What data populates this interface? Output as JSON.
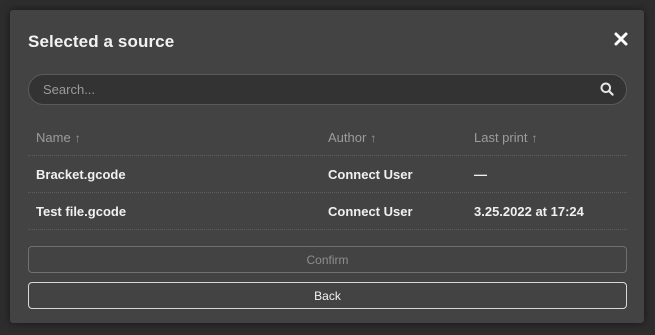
{
  "dialog": {
    "title": "Selected a source",
    "close_icon": "close-icon"
  },
  "search": {
    "placeholder": "Search...",
    "value": "",
    "icon": "search-icon"
  },
  "table": {
    "columns": [
      {
        "label": "Name",
        "sort_indicator": "↑"
      },
      {
        "label": "Author",
        "sort_indicator": "↑"
      },
      {
        "label": "Last print",
        "sort_indicator": "↑"
      }
    ],
    "rows": [
      {
        "name": "Bracket.gcode",
        "author": "Connect User",
        "last_print": "—"
      },
      {
        "name": "Test file.gcode",
        "author": "Connect User",
        "last_print": "3.25.2022 at 17:24"
      }
    ]
  },
  "buttons": {
    "confirm_label": "Confirm",
    "back_label": "Back"
  },
  "colors": {
    "dialog_bg": "#434343",
    "backdrop": "#2d2d2d",
    "text": "#f0f0f0",
    "muted": "#9c9c9c"
  }
}
